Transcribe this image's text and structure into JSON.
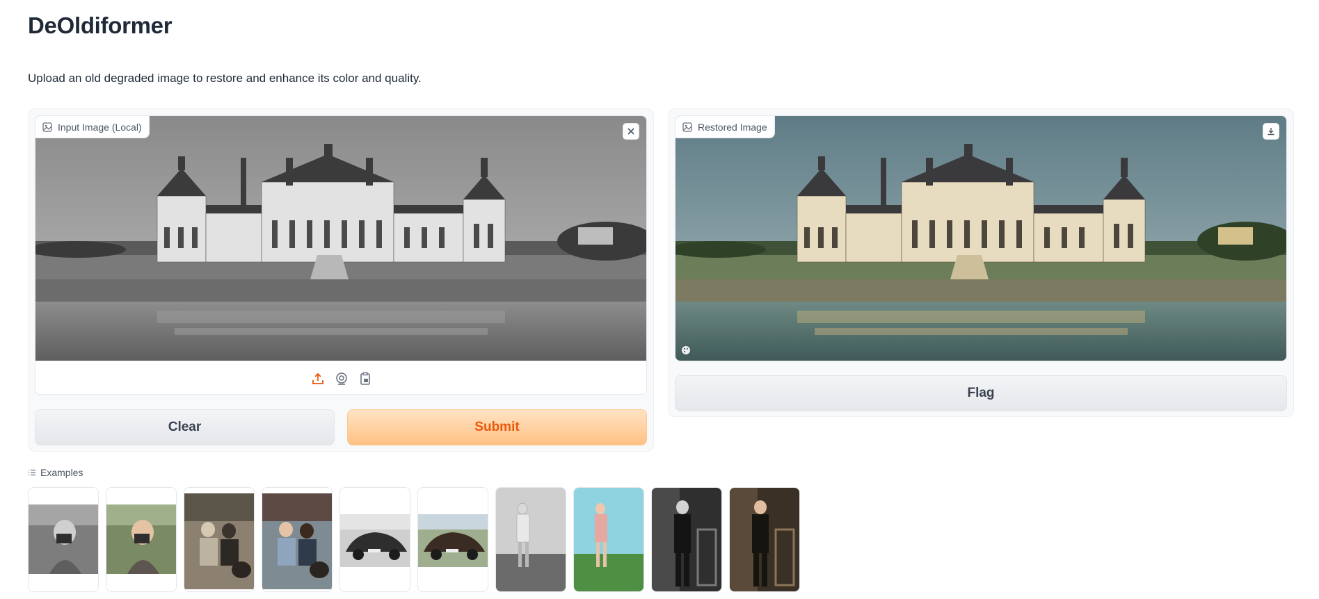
{
  "app": {
    "title": "DeOldiformer",
    "description": "Upload an old degraded image to restore and enhance its color and quality."
  },
  "input_panel": {
    "image_label": "Input Image (Local)",
    "clear_label": "Clear",
    "submit_label": "Submit",
    "icons": [
      "upload-icon",
      "webcam-icon",
      "clipboard-icon",
      "close-icon",
      "image-icon"
    ]
  },
  "output_panel": {
    "image_label": "Restored Image",
    "flag_label": "Flag",
    "icons": [
      "download-icon",
      "palette-icon",
      "image-icon"
    ]
  },
  "examples": {
    "label": "Examples",
    "items": [
      {
        "subject": "boy-with-camera",
        "tone": "grayscale"
      },
      {
        "subject": "boy-with-camera",
        "tone": "color"
      },
      {
        "subject": "two-boys-on-cart",
        "tone": "sepia"
      },
      {
        "subject": "two-boys-on-cart",
        "tone": "color"
      },
      {
        "subject": "vintage-car",
        "tone": "grayscale"
      },
      {
        "subject": "vintage-car",
        "tone": "color"
      },
      {
        "subject": "girl-in-field",
        "tone": "grayscale"
      },
      {
        "subject": "girl-in-field",
        "tone": "color"
      },
      {
        "subject": "man-in-suit",
        "tone": "grayscale"
      },
      {
        "subject": "man-in-suit",
        "tone": "color"
      }
    ]
  },
  "colors": {
    "accent": "#ea580c",
    "submit_bg": "#ffc184",
    "panel_bg": "#f8f9fb",
    "text": "#1f2937"
  }
}
